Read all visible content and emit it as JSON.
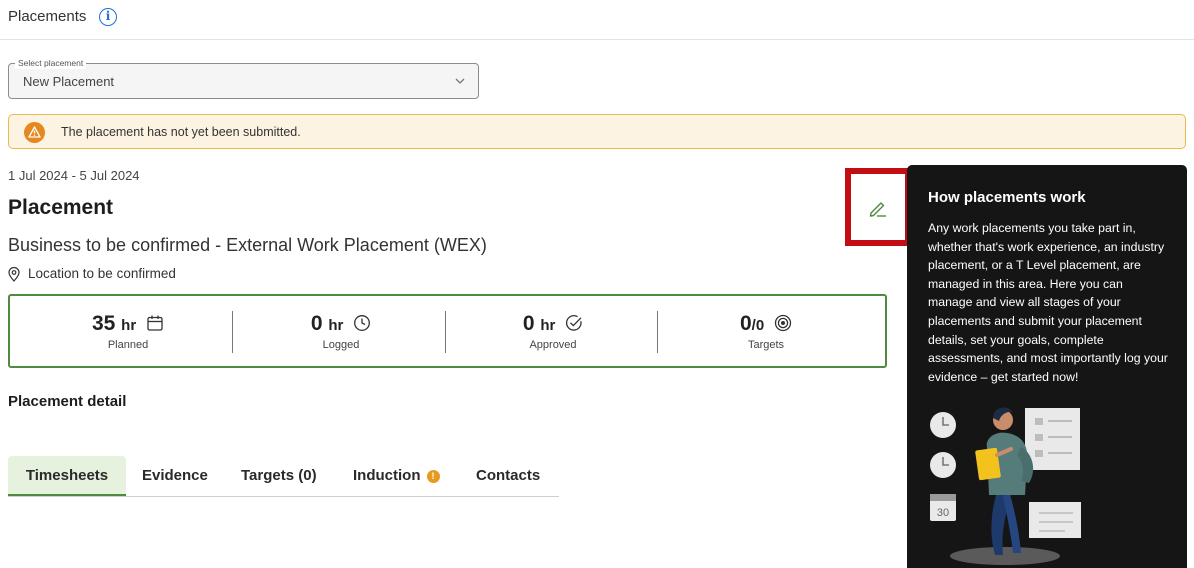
{
  "header": {
    "title": "Placements",
    "info_icon_glyph": "i"
  },
  "select_placement": {
    "label": "Select placement",
    "value": "New Placement"
  },
  "warning": {
    "text": "The placement has not yet been submitted."
  },
  "placement": {
    "dates": "1 Jul 2024 - 5 Jul 2024",
    "title": "Placement",
    "business": "Business to be confirmed - External Work Placement (WEX)",
    "location": "Location to be confirmed"
  },
  "stats": [
    {
      "value": "35",
      "unit": "hr",
      "label": "Planned",
      "icon": "calendar-icon"
    },
    {
      "value": "0",
      "unit": "hr",
      "label": "Logged",
      "icon": "clock-icon"
    },
    {
      "value": "0",
      "unit": "hr",
      "label": "Approved",
      "icon": "check-circle-icon"
    },
    {
      "value": "0",
      "unit": "/0",
      "label": "Targets",
      "icon": "target-icon"
    }
  ],
  "detail_heading": "Placement detail",
  "tabs": [
    {
      "label": "Timesheets",
      "active": true
    },
    {
      "label": "Evidence"
    },
    {
      "label": "Targets (0)"
    },
    {
      "label": "Induction",
      "badge": "!"
    },
    {
      "label": "Contacts"
    }
  ],
  "info_panel": {
    "title": "How placements work",
    "body": "Any work placements you take part in, whether that's work experience, an industry placement, or a T Level placement, are managed in this area. Here you can manage and view all stages of your placements and submit your placement details, set your goals, complete assessments, and most importantly log your evidence – get started now!",
    "calendar_number": "30"
  },
  "colors": {
    "accent_green": "#4f8a3e",
    "warning_orange": "#e5881e",
    "warning_bg": "#fdf3e2",
    "highlight_red": "#c30d12",
    "info_blue": "#1f6fd1",
    "panel_bg": "#151515"
  }
}
